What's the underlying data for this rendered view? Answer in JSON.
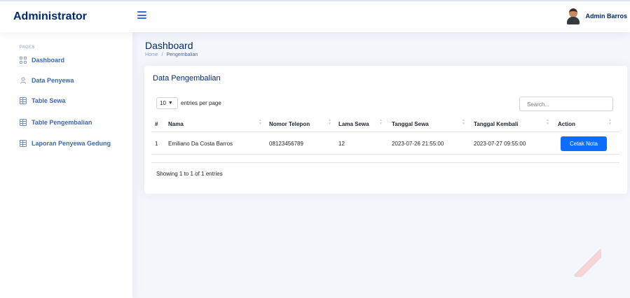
{
  "header": {
    "brand": "Administrator",
    "user_name": "Admin Barros"
  },
  "sidebar": {
    "heading": "PAGES",
    "items": [
      {
        "label": "Dashboard",
        "icon": "grid-icon"
      },
      {
        "label": "Data Penyewa",
        "icon": "person-icon"
      },
      {
        "label": "Table Sewa",
        "icon": "table-icon"
      },
      {
        "label": "Table Pengembalian",
        "icon": "table-icon"
      },
      {
        "label": "Laporan Penyewa Gedung",
        "icon": "table-icon"
      }
    ]
  },
  "main": {
    "title": "Dashboard",
    "breadcrumb": {
      "home": "Home",
      "separator": "/",
      "current": "Pengembalian"
    }
  },
  "card": {
    "title": "Data Pengembalian",
    "entries_value": "10",
    "entries_label": "entries per page",
    "search_placeholder": "Search...",
    "columns": [
      "#",
      "Nama",
      "Nomor Telepon",
      "Lama Sewa",
      "Tanggal Sewa",
      "Tanggal Kembali",
      "Action"
    ],
    "rows": [
      {
        "no": "1",
        "nama": "Emiliano Da Costa Barros",
        "telepon": "08123456789",
        "lama": "12",
        "tanggal_sewa": "2023-07-26 21:55:00",
        "tanggal_kembali": "2023-07-27 09:55:00",
        "action": "Cetak Nota"
      }
    ],
    "info": "Showing 1 to 1 of 1 entries"
  },
  "colors": {
    "primary": "#0d6efd",
    "brand": "#012970",
    "background": "#f3f6fb"
  }
}
